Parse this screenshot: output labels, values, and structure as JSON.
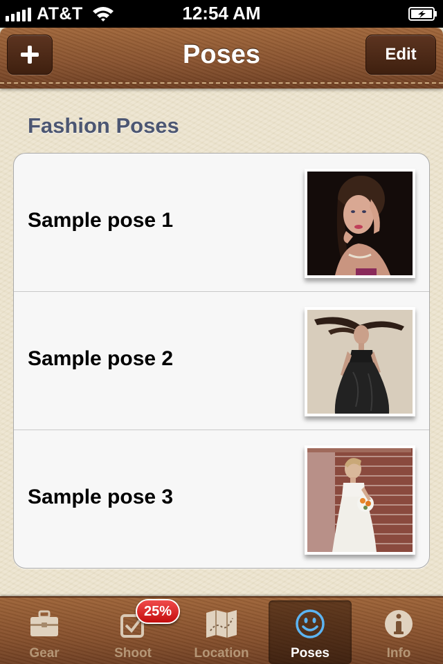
{
  "status_bar": {
    "carrier": "AT&T",
    "time": "12:54 AM"
  },
  "nav": {
    "title": "Poses",
    "edit_label": "Edit"
  },
  "section": {
    "title": "Fashion Poses"
  },
  "poses": [
    {
      "label": "Sample pose 1"
    },
    {
      "label": "Sample pose 2"
    },
    {
      "label": "Sample pose 3"
    }
  ],
  "tab_bar": {
    "tabs": [
      {
        "label": "Gear",
        "icon": "toolbox-icon",
        "selected": false
      },
      {
        "label": "Shoot",
        "icon": "checkbox-icon",
        "selected": false,
        "badge": "25%"
      },
      {
        "label": "Location",
        "icon": "map-icon",
        "selected": false
      },
      {
        "label": "Poses",
        "icon": "smiley-icon",
        "selected": true
      },
      {
        "label": "Info",
        "icon": "info-icon",
        "selected": false
      }
    ]
  },
  "colors": {
    "leather": "#8a5430",
    "section_text": "#4c5672",
    "badge": "#d81b1b",
    "selected_icon": "#4aa3e8"
  }
}
